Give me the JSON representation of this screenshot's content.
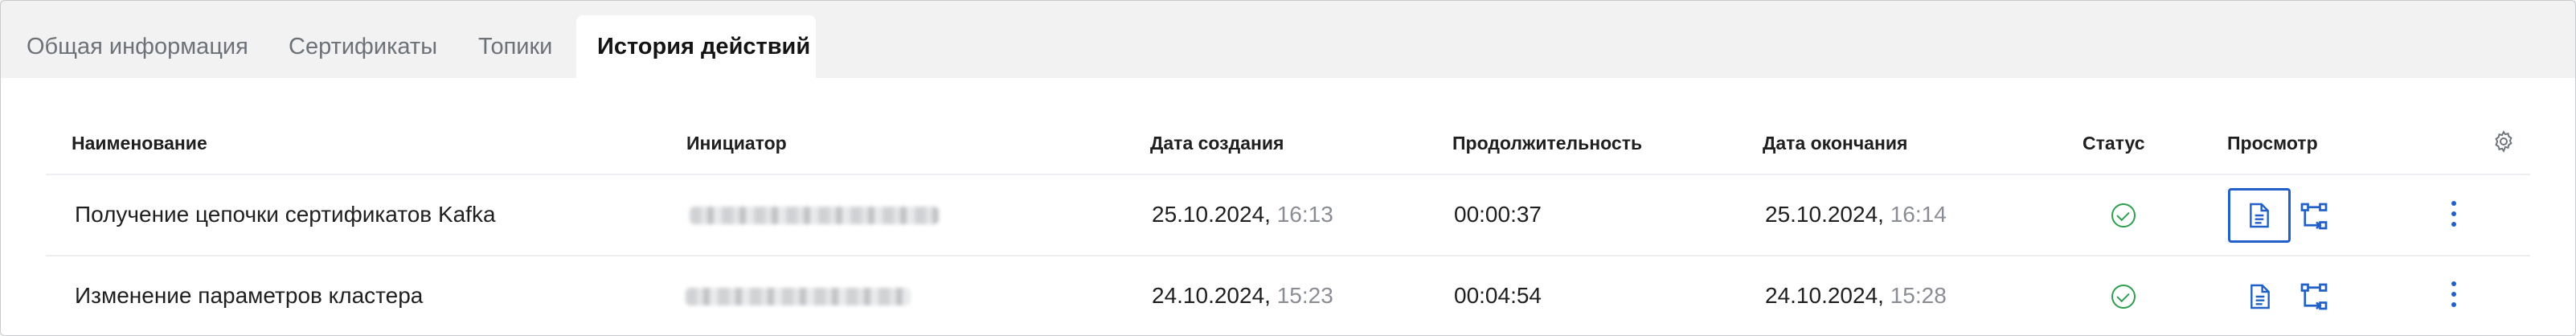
{
  "tabs": [
    {
      "label": "Общая информация",
      "active": false
    },
    {
      "label": "Сертификаты",
      "active": false
    },
    {
      "label": "Топики",
      "active": false
    },
    {
      "label": "История действий",
      "active": true
    }
  ],
  "table": {
    "columns": [
      "Наименование",
      "Инициатор",
      "Дата создания",
      "Продолжительность",
      "Дата окончания",
      "Статус",
      "Просмотр"
    ],
    "rows": [
      {
        "name": "Получение цепочки сертификатов Kafka",
        "created_date": "25.10.2024,",
        "created_time": "16:13",
        "duration": "00:00:37",
        "ended_date": "25.10.2024,",
        "ended_time": "16:14",
        "status": "success"
      },
      {
        "name": "Изменение параметров кластера",
        "created_date": "24.10.2024,",
        "created_time": "15:23",
        "duration": "00:04:54",
        "ended_date": "24.10.2024,",
        "ended_time": "15:28",
        "status": "success"
      }
    ]
  },
  "icons": {
    "settings": "gear-icon",
    "view_document": "document-icon",
    "view_graph": "flow-graph-icon",
    "more": "more-vertical-icon",
    "status_ok": "check-circle-icon"
  },
  "colors": {
    "accent": "#2160c8",
    "success": "#2e9e4f",
    "muted_text": "#8a8d93",
    "tab_bg": "#f2f2f3"
  }
}
